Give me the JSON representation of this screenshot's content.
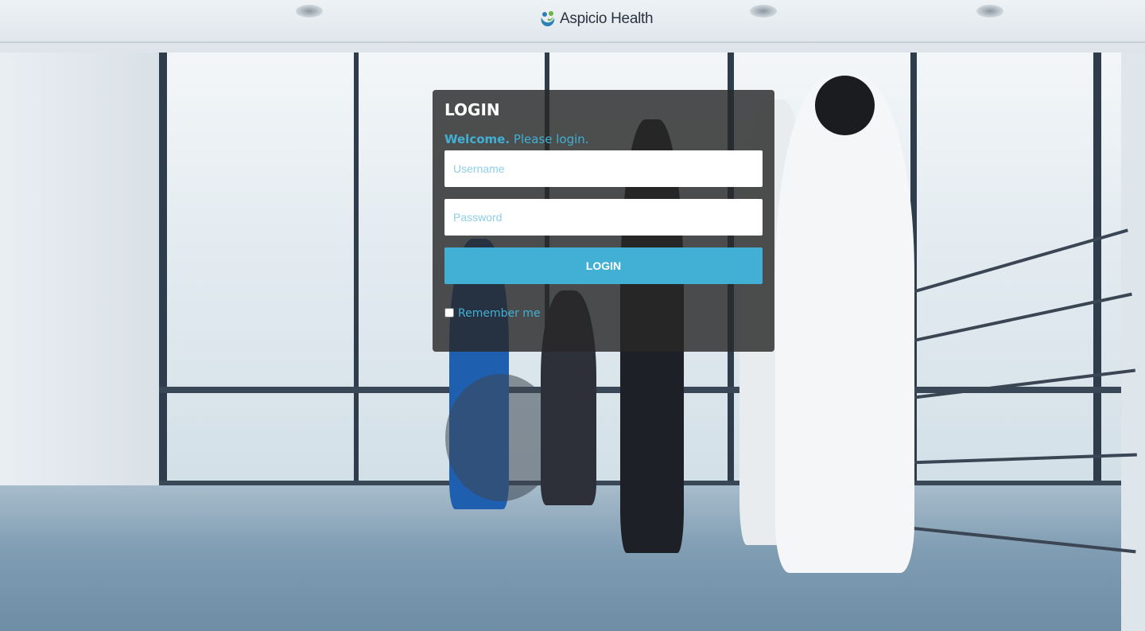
{
  "header": {
    "brand_name": "Aspicio Health"
  },
  "login": {
    "title": "LOGIN",
    "welcome_strong": "Welcome.",
    "welcome_rest": "Please login.",
    "username_placeholder": "Username",
    "username_value": "",
    "password_placeholder": "Password",
    "password_value": "",
    "submit_label": "LOGIN",
    "remember_label": "Remember me",
    "remember_checked": false
  },
  "colors": {
    "accent": "#41b0d4",
    "panel_background": "#282828",
    "logo_blue": "#2d7fb8",
    "logo_green": "#6ab344"
  },
  "icons": {
    "logo": "aspicio-health-logo-icon"
  }
}
